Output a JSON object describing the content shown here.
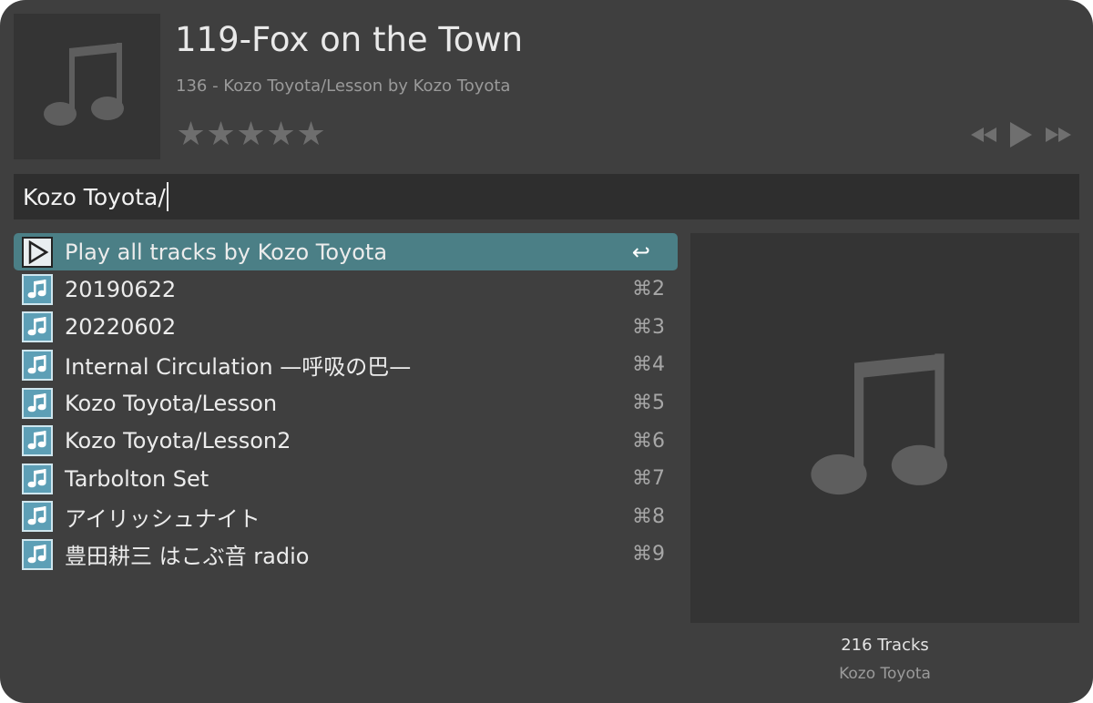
{
  "now_playing": {
    "title": "119-Fox on the Town",
    "subtitle": "136 - Kozo Toyota/Lesson by Kozo Toyota",
    "rating": 0,
    "rating_max": 5,
    "star_glyph": "★",
    "artwork_icon": "music-note-icon"
  },
  "controls": {
    "previous_icon": "rewind-icon",
    "play_icon": "play-icon",
    "next_icon": "fast-forward-icon"
  },
  "search": {
    "query": "Kozo Toyota/"
  },
  "results": [
    {
      "label": "Play all tracks by Kozo Toyota",
      "shortcut": "↩",
      "icon": "play-icon",
      "selected": true
    },
    {
      "label": "20190622",
      "shortcut": "⌘2",
      "icon": "music-note-icon",
      "selected": false
    },
    {
      "label": "20220602",
      "shortcut": "⌘3",
      "icon": "music-note-icon",
      "selected": false
    },
    {
      "label": "Internal Circulation —呼吸の巴—",
      "shortcut": "⌘4",
      "icon": "music-note-icon",
      "selected": false
    },
    {
      "label": "Kozo Toyota/Lesson",
      "shortcut": "⌘5",
      "icon": "music-note-icon",
      "selected": false
    },
    {
      "label": "Kozo Toyota/Lesson2",
      "shortcut": "⌘6",
      "icon": "music-note-icon",
      "selected": false
    },
    {
      "label": "Tarbolton Set",
      "shortcut": "⌘7",
      "icon": "music-note-icon",
      "selected": false
    },
    {
      "label": "アイリッシュナイト",
      "shortcut": "⌘8",
      "icon": "music-note-icon",
      "selected": false
    },
    {
      "label": "豊田耕三 はこぶ音 radio",
      "shortcut": "⌘9",
      "icon": "music-note-icon",
      "selected": false
    }
  ],
  "preview": {
    "track_count": "216 Tracks",
    "artist": "Kozo Toyota",
    "artwork_icon": "music-note-icon"
  },
  "colors": {
    "background": "#3f3f3f",
    "panel": "#343434",
    "search_bg": "#2e2e2e",
    "selection": "#4b7f86",
    "icon_accent": "#5d9fb6"
  }
}
